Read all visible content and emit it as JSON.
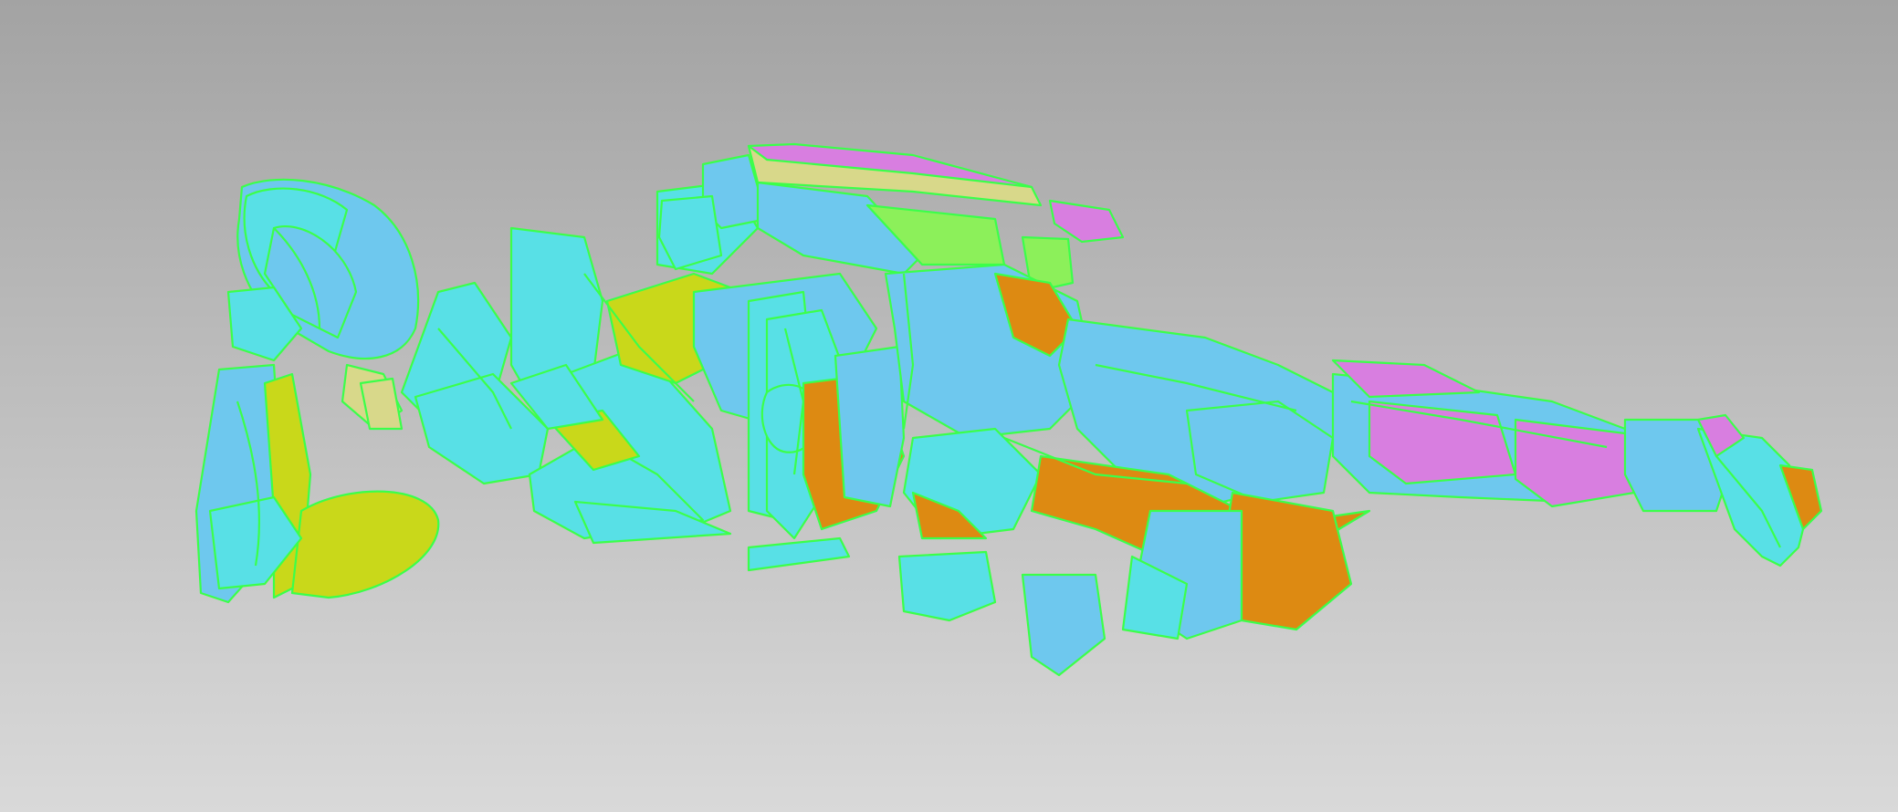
{
  "viewport": {
    "background_top": "#a3a3a3",
    "background_bottom": "#d9d9d9"
  },
  "scan": {
    "subject": "reclining-figure-point-cloud",
    "patch_colors": {
      "cyan": "#58e0e6",
      "sky": "#6ec8ee",
      "yellow": "#c9d81a",
      "lime": "#8cf05a",
      "orange": "#dd8a12",
      "magenta": "#d87ee0",
      "khaki": "#d8d88a"
    },
    "edge_color": "#3bff4a"
  }
}
